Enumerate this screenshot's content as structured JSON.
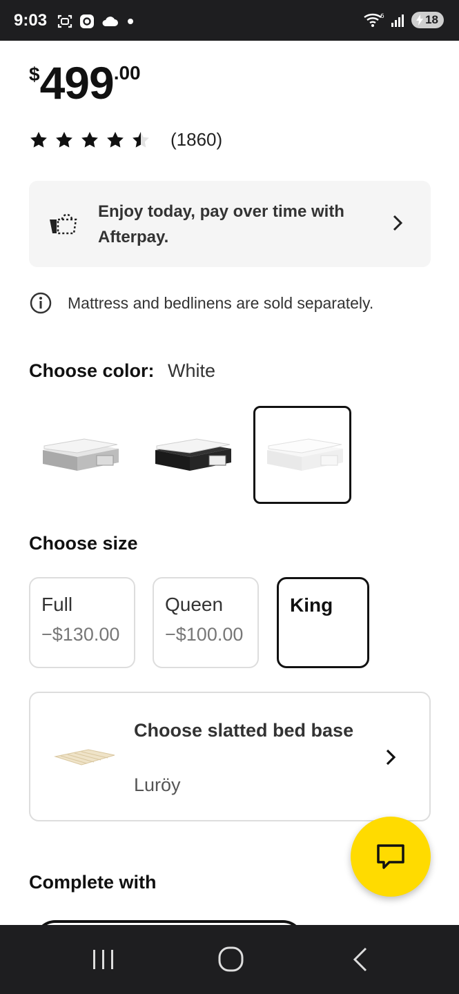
{
  "status_bar": {
    "time": "9:03",
    "battery": "18"
  },
  "price": {
    "currency": "$",
    "main": "499",
    "cents": ".00"
  },
  "rating": {
    "stars": 4.5,
    "max_stars": 5,
    "count": "(1860)"
  },
  "afterpay": {
    "text": "Enjoy today, pay over time with Afterpay."
  },
  "info": {
    "text": "Mattress and bedlinens are sold separately."
  },
  "color": {
    "label": "Choose color:",
    "selected": "White",
    "options": [
      "gray",
      "black-brown",
      "white"
    ]
  },
  "size": {
    "label": "Choose size",
    "options": [
      {
        "name": "Full",
        "price": "−$130.00"
      },
      {
        "name": "Queen",
        "price": "−$100.00"
      },
      {
        "name": "King",
        "price": ""
      }
    ],
    "selected": "King"
  },
  "slatted_base": {
    "title": "Choose slatted bed base",
    "subtitle": "Luröy"
  },
  "complete_with": {
    "label": "Complete with"
  },
  "colors": {
    "accent_yellow": "#ffdb00",
    "system_bar": "#1e1e20"
  }
}
